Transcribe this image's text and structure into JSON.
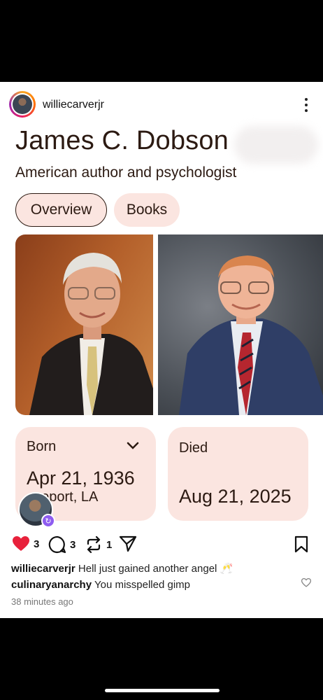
{
  "post": {
    "username": "williecarverjr",
    "card": {
      "title": "James C. Dobson",
      "subtitle": "American author and psychologist",
      "tabs": [
        "Overview",
        "Books"
      ],
      "born_label": "Born",
      "born_date": "Apr 21, 1936",
      "born_place": "eveport, LA",
      "died_label": "Died",
      "died_date": "Aug 21, 2025"
    },
    "actions": {
      "likes": "3",
      "comments": "3",
      "reposts": "1"
    },
    "comments": [
      {
        "user": "williecarverjr",
        "text": "Hell just gained another angel 🥂"
      },
      {
        "user": "culinaryanarchy",
        "text": "You misspelled gimp"
      }
    ],
    "timestamp": "38 minutes ago"
  },
  "colors": {
    "card_bg": "#fbe5e0",
    "text_dark": "#2c1a12",
    "like_red": "#e8213b",
    "boost_purple": "#8e5cf0"
  }
}
